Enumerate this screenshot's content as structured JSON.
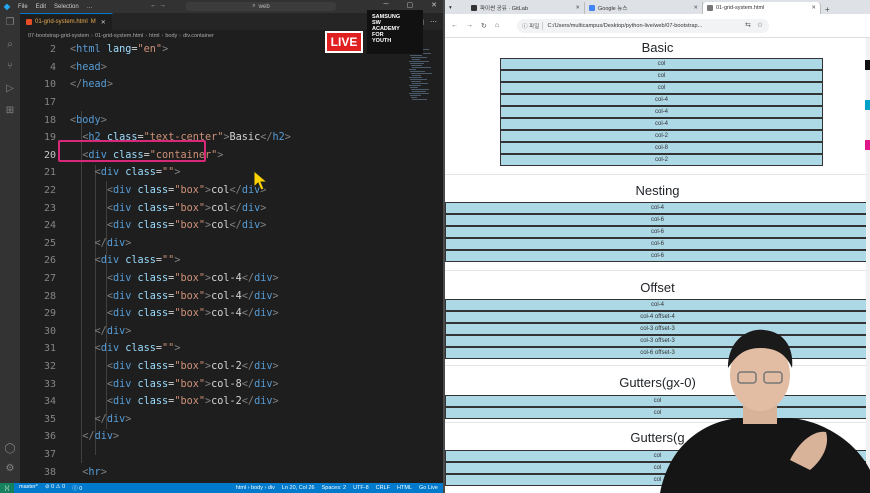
{
  "vscode": {
    "menu": [
      "File",
      "Edit",
      "Selection",
      "…"
    ],
    "command_center": "web",
    "tabs": [
      {
        "label": "01-grid-system.html",
        "badge": "M"
      }
    ],
    "breadcrumb": [
      "07-bootstrap-grid-system",
      "01-grid-system.html",
      "html",
      "body",
      "div.container"
    ],
    "lines": [
      {
        "n": "2",
        "html": "<span class='tg'>&lt;</span><span class='tn'>html</span> <span class='at'>lang</span><span class='tx'>=</span><span class='av'>\"en\"</span><span class='tg'>&gt;</span>"
      },
      {
        "n": "4",
        "html": "<span class='tg'>&lt;</span><span class='tn'>head</span><span class='tg'>&gt;</span>"
      },
      {
        "n": "10",
        "html": "<span class='tg'>&lt;/</span><span class='tn'>head</span><span class='tg'>&gt;</span>"
      },
      {
        "n": "17",
        "html": ""
      },
      {
        "n": "18",
        "html": "<span class='tg'>&lt;</span><span class='tn'>body</span><span class='tg'>&gt;</span>"
      },
      {
        "n": "19",
        "html": "  <span class='tg'>&lt;</span><span class='tn'>h2</span> <span class='at'>class</span><span class='tx'>=</span><span class='av'>\"text-center\"</span><span class='tg'>&gt;</span><span class='tx'>Basic</span><span class='tg'>&lt;/</span><span class='tn'>h2</span><span class='tg'>&gt;</span>"
      },
      {
        "n": "20",
        "html": "  <span class='tg'>&lt;</span><span class='tn'>div</span> <span class='at'>class</span><span class='tx'>=</span><span class='av'>\"container\"</span><span class='tg'>&gt;</span>"
      },
      {
        "n": "21",
        "html": "    <span class='tg'>&lt;</span><span class='tn'>div</span> <span class='at'>class</span><span class='tx'>=</span><span class='av'>\"\"</span><span class='tg'>&gt;</span>"
      },
      {
        "n": "22",
        "html": "      <span class='tg'>&lt;</span><span class='tn'>div</span> <span class='at'>class</span><span class='tx'>=</span><span class='av'>\"box\"</span><span class='tg'>&gt;</span><span class='tx'>col</span><span class='tg'>&lt;/</span><span class='tn'>div</span><span class='tg'>&gt;</span>"
      },
      {
        "n": "23",
        "html": "      <span class='tg'>&lt;</span><span class='tn'>div</span> <span class='at'>class</span><span class='tx'>=</span><span class='av'>\"box\"</span><span class='tg'>&gt;</span><span class='tx'>col</span><span class='tg'>&lt;/</span><span class='tn'>div</span><span class='tg'>&gt;</span>"
      },
      {
        "n": "24",
        "html": "      <span class='tg'>&lt;</span><span class='tn'>div</span> <span class='at'>class</span><span class='tx'>=</span><span class='av'>\"box\"</span><span class='tg'>&gt;</span><span class='tx'>col</span><span class='tg'>&lt;/</span><span class='tn'>div</span><span class='tg'>&gt;</span>"
      },
      {
        "n": "25",
        "html": "    <span class='tg'>&lt;/</span><span class='tn'>div</span><span class='tg'>&gt;</span>"
      },
      {
        "n": "26",
        "html": "    <span class='tg'>&lt;</span><span class='tn'>div</span> <span class='at'>class</span><span class='tx'>=</span><span class='av'>\"\"</span><span class='tg'>&gt;</span>"
      },
      {
        "n": "27",
        "html": "      <span class='tg'>&lt;</span><span class='tn'>div</span> <span class='at'>class</span><span class='tx'>=</span><span class='av'>\"box\"</span><span class='tg'>&gt;</span><span class='tx'>col-4</span><span class='tg'>&lt;/</span><span class='tn'>div</span><span class='tg'>&gt;</span>"
      },
      {
        "n": "28",
        "html": "      <span class='tg'>&lt;</span><span class='tn'>div</span> <span class='at'>class</span><span class='tx'>=</span><span class='av'>\"box\"</span><span class='tg'>&gt;</span><span class='tx'>col-4</span><span class='tg'>&lt;/</span><span class='tn'>div</span><span class='tg'>&gt;</span>"
      },
      {
        "n": "29",
        "html": "      <span class='tg'>&lt;</span><span class='tn'>div</span> <span class='at'>class</span><span class='tx'>=</span><span class='av'>\"box\"</span><span class='tg'>&gt;</span><span class='tx'>col-4</span><span class='tg'>&lt;/</span><span class='tn'>div</span><span class='tg'>&gt;</span>"
      },
      {
        "n": "30",
        "html": "    <span class='tg'>&lt;/</span><span class='tn'>div</span><span class='tg'>&gt;</span>"
      },
      {
        "n": "31",
        "html": "    <span class='tg'>&lt;</span><span class='tn'>div</span> <span class='at'>class</span><span class='tx'>=</span><span class='av'>\"\"</span><span class='tg'>&gt;</span>"
      },
      {
        "n": "32",
        "html": "      <span class='tg'>&lt;</span><span class='tn'>div</span> <span class='at'>class</span><span class='tx'>=</span><span class='av'>\"box\"</span><span class='tg'>&gt;</span><span class='tx'>col-2</span><span class='tg'>&lt;/</span><span class='tn'>div</span><span class='tg'>&gt;</span>"
      },
      {
        "n": "33",
        "html": "      <span class='tg'>&lt;</span><span class='tn'>div</span> <span class='at'>class</span><span class='tx'>=</span><span class='av'>\"box\"</span><span class='tg'>&gt;</span><span class='tx'>col-8</span><span class='tg'>&lt;/</span><span class='tn'>div</span><span class='tg'>&gt;</span>"
      },
      {
        "n": "34",
        "html": "      <span class='tg'>&lt;</span><span class='tn'>div</span> <span class='at'>class</span><span class='tx'>=</span><span class='av'>\"box\"</span><span class='tg'>&gt;</span><span class='tx'>col-2</span><span class='tg'>&lt;/</span><span class='tn'>div</span><span class='tg'>&gt;</span>"
      },
      {
        "n": "35",
        "html": "    <span class='tg'>&lt;/</span><span class='tn'>div</span><span class='tg'>&gt;</span>"
      },
      {
        "n": "36",
        "html": "  <span class='tg'>&lt;/</span><span class='tn'>div</span><span class='tg'>&gt;</span>"
      },
      {
        "n": "37",
        "html": ""
      },
      {
        "n": "38",
        "html": "  <span class='tg'>&lt;</span><span class='tn'>hr</span><span class='tg'>&gt;</span>"
      }
    ],
    "current_line": "20",
    "status": {
      "branch": "master*",
      "problems": "⊘ 0 ⚠ 0",
      "ports": "Ⓘ 0",
      "breadcrumb": "html › body › div",
      "position": "Ln 20, Col 26",
      "spaces": "Spaces: 2",
      "encoding": "UTF-8",
      "eol": "CRLF",
      "lang": "HTML",
      "golive": "Go Live"
    }
  },
  "browser": {
    "tabs": [
      {
        "label": "파이썬 공유 · GitLab"
      },
      {
        "label": "Google 뉴스"
      },
      {
        "label": "01-grid-system.html"
      }
    ],
    "address_prefix": "파일",
    "address": "C:/Users/multicampus/Desktop/python-live/web/07-bootstrap...",
    "live_label": "LIVE",
    "brand_lines": [
      "SAMSUNG",
      "SW",
      "ACADEMY",
      "FOR",
      "YOUTH"
    ],
    "sections": [
      {
        "title": "Basic",
        "boxes": [
          "col",
          "col",
          "col",
          "col-4",
          "col-4",
          "col-4",
          "col-2",
          "col-8",
          "col-2"
        ]
      },
      {
        "title": "Nesting",
        "boxes": [
          "col-4",
          "col-6",
          "col-6",
          "col-6",
          "col-6"
        ]
      },
      {
        "title": "Offset",
        "boxes": [
          "col-4",
          "col-4 offset-4",
          "col-3 offset-3",
          "col-3 offset-3",
          "col-6 offset-3"
        ]
      },
      {
        "title": "Gutters(gx-0)",
        "boxes": [
          "col",
          "col"
        ]
      },
      {
        "title": "Gutters(g",
        "boxes": [
          "col",
          "col",
          "col"
        ]
      }
    ]
  },
  "colors": {
    "box_fill": "#add8e6",
    "highlight": "#d8287a",
    "accent": "#007acc"
  }
}
